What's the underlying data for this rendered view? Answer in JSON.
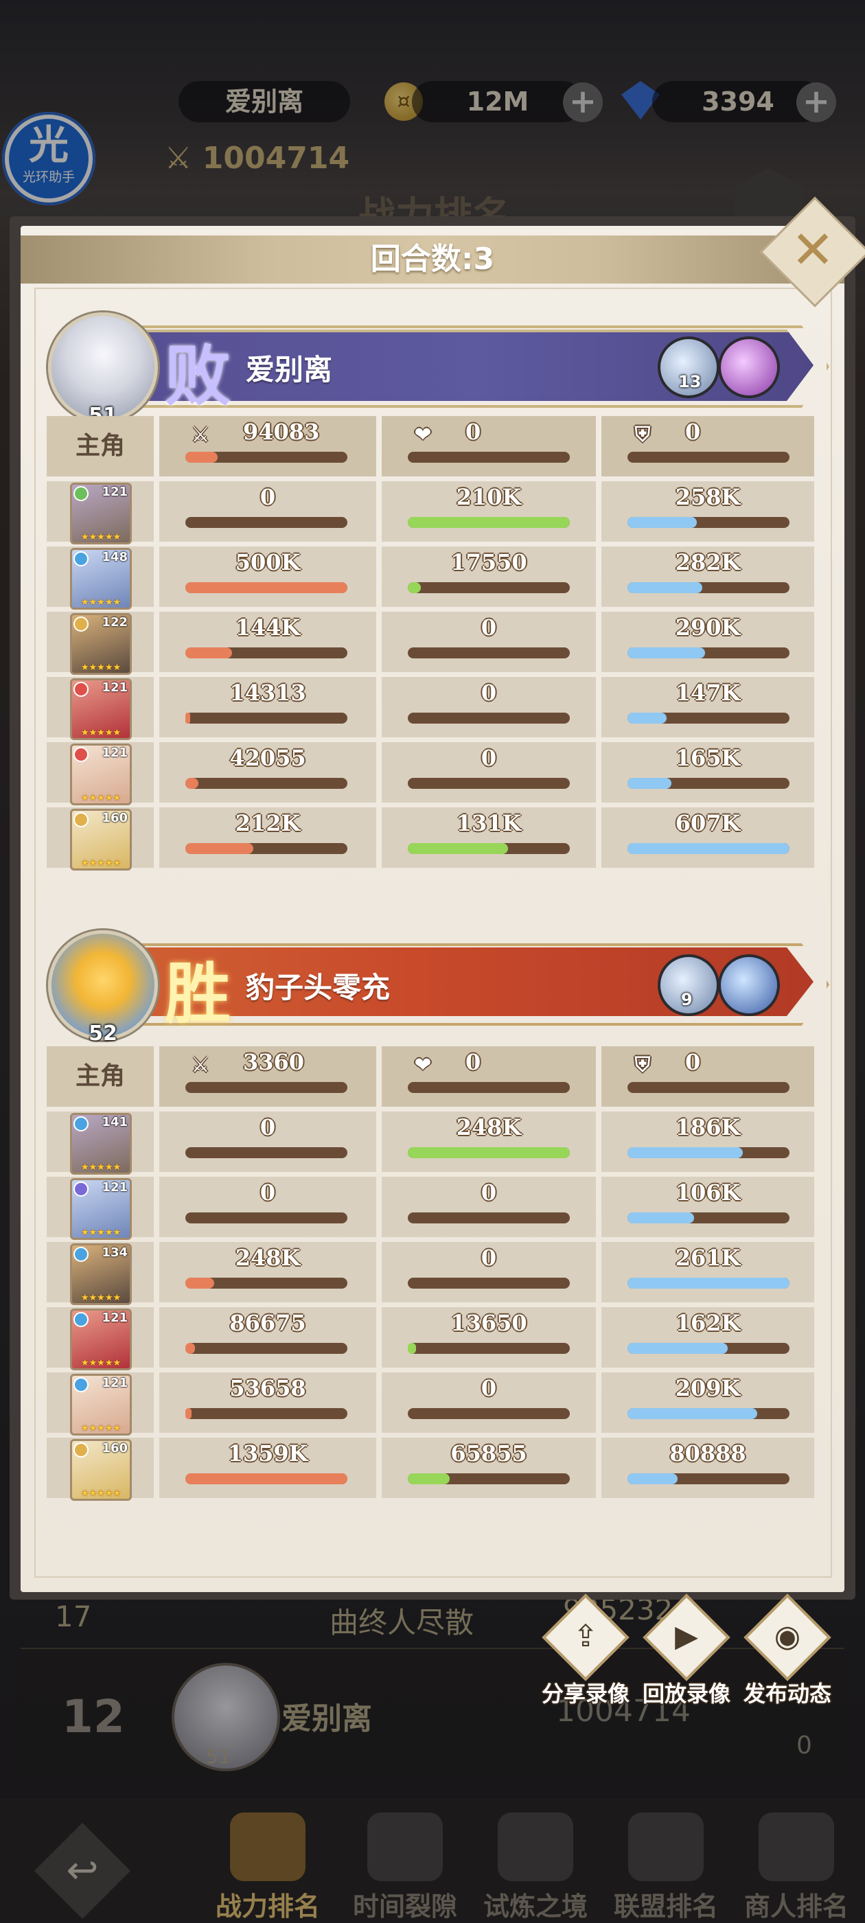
{
  "background": {
    "player_name": "爱别离",
    "gold": "12M",
    "gems": "3394",
    "power": "1004714",
    "screen_title": "战力排名",
    "row17_rank": "17",
    "row17_name": "曲终人尽散",
    "row17_power": "925232",
    "my_rank": "12",
    "my_name": "爱别离",
    "my_level": "51",
    "my_power": "1004714",
    "likes": "0",
    "app_badge": {
      "glyph": "光",
      "label": "光环助手"
    }
  },
  "nav": {
    "back_icon": "back-arrow-icon",
    "tabs": [
      {
        "label": "战力排名",
        "active": true
      },
      {
        "label": "时间裂隙",
        "active": false
      },
      {
        "label": "试炼之境",
        "active": false
      },
      {
        "label": "联盟排名",
        "active": false
      },
      {
        "label": "商人排名",
        "active": false
      }
    ]
  },
  "dialog": {
    "title": "回合数:3",
    "close_icon": "close-icon",
    "role_label": "主角",
    "stat_icons": {
      "damage": "⚔",
      "heal": "❤",
      "tank": "⛨"
    },
    "teams": [
      {
        "result": "败",
        "name": "爱别离",
        "level": "51",
        "pets": [
          {
            "level": "13"
          },
          {
            "level": ""
          }
        ],
        "lead": {
          "damage": "94083",
          "heal": "0",
          "tank": "0",
          "damage_frac": 0.2,
          "heal_frac": 0,
          "tank_frac": 0
        },
        "heroes": [
          {
            "level": "121",
            "damage": "0",
            "heal": "210K",
            "tank": "258K",
            "damage_frac": 0,
            "heal_frac": 1.0,
            "tank_frac": 0.43
          },
          {
            "level": "148",
            "damage": "500K",
            "heal": "17550",
            "tank": "282K",
            "damage_frac": 1.0,
            "heal_frac": 0.08,
            "tank_frac": 0.46
          },
          {
            "level": "122",
            "damage": "144K",
            "heal": "0",
            "tank": "290K",
            "damage_frac": 0.29,
            "heal_frac": 0,
            "tank_frac": 0.48
          },
          {
            "level": "121",
            "damage": "14313",
            "heal": "0",
            "tank": "147K",
            "damage_frac": 0.03,
            "heal_frac": 0,
            "tank_frac": 0.24
          },
          {
            "level": "121",
            "damage": "42055",
            "heal": "0",
            "tank": "165K",
            "damage_frac": 0.08,
            "heal_frac": 0,
            "tank_frac": 0.27
          },
          {
            "level": "160",
            "damage": "212K",
            "heal": "131K",
            "tank": "607K",
            "damage_frac": 0.42,
            "heal_frac": 0.62,
            "tank_frac": 1.0
          }
        ]
      },
      {
        "result": "胜",
        "name": "豹子头零充",
        "level": "52",
        "pets": [
          {
            "level": "9"
          },
          {
            "level": ""
          }
        ],
        "lead": {
          "damage": "3360",
          "heal": "0",
          "tank": "0",
          "damage_frac": 0,
          "heal_frac": 0,
          "tank_frac": 0
        },
        "heroes": [
          {
            "level": "141",
            "damage": "0",
            "heal": "248K",
            "tank": "186K",
            "damage_frac": 0,
            "heal_frac": 1.0,
            "tank_frac": 0.71
          },
          {
            "level": "121",
            "damage": "0",
            "heal": "0",
            "tank": "106K",
            "damage_frac": 0,
            "heal_frac": 0,
            "tank_frac": 0.41
          },
          {
            "level": "134",
            "damage": "248K",
            "heal": "0",
            "tank": "261K",
            "damage_frac": 0.18,
            "heal_frac": 0,
            "tank_frac": 1.0
          },
          {
            "level": "121",
            "damage": "86675",
            "heal": "13650",
            "tank": "162K",
            "damage_frac": 0.06,
            "heal_frac": 0.05,
            "tank_frac": 0.62
          },
          {
            "level": "121",
            "damage": "53658",
            "heal": "0",
            "tank": "209K",
            "damage_frac": 0.04,
            "heal_frac": 0,
            "tank_frac": 0.8
          },
          {
            "level": "160",
            "damage": "1359K",
            "heal": "65855",
            "tank": "80888",
            "damage_frac": 1.0,
            "heal_frac": 0.26,
            "tank_frac": 0.31
          }
        ]
      }
    ]
  },
  "actions": [
    {
      "label": "分享录像",
      "icon": "share-icon"
    },
    {
      "label": "回放录像",
      "icon": "play-icon"
    },
    {
      "label": "发布动态",
      "icon": "camera-icon"
    }
  ],
  "colors": {
    "damage_bar": "#e7805a",
    "heal_bar": "#98d65a",
    "tank_bar": "#8fc8f2",
    "defeat_banner": "#5a5396",
    "victory_banner": "#c84a2b"
  }
}
